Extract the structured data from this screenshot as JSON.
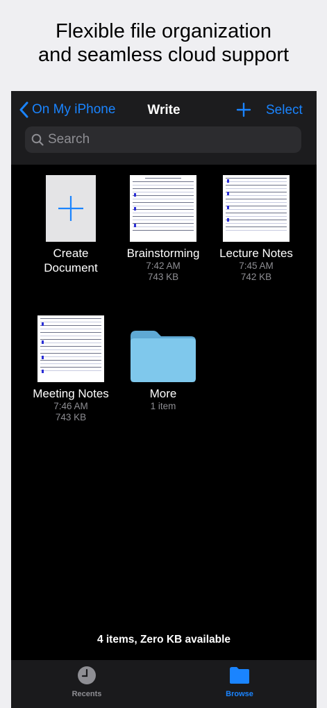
{
  "promo": {
    "line1": "Flexible file organization",
    "line2": "and seamless cloud support"
  },
  "nav": {
    "back_label": "On My iPhone",
    "title": "Write",
    "select_label": "Select"
  },
  "search": {
    "placeholder": "Search"
  },
  "files": {
    "create": {
      "line1": "Create",
      "line2": "Document"
    },
    "items": [
      {
        "name": "Brainstorming",
        "time": "7:42 AM",
        "size": "743 KB"
      },
      {
        "name": "Lecture Notes",
        "time": "7:45 AM",
        "size": "742 KB"
      },
      {
        "name": "Meeting Notes",
        "time": "7:46 AM",
        "size": "743 KB"
      },
      {
        "name": "More",
        "count": "1 item"
      }
    ]
  },
  "footer": {
    "status": "4 items, Zero KB available"
  },
  "tabs": [
    {
      "label": "Recents",
      "icon": "clock-icon",
      "active": false
    },
    {
      "label": "Browse",
      "icon": "folder-icon",
      "active": true
    }
  ],
  "colors": {
    "accent": "#1a84ff",
    "folder": "#7fc8ec",
    "background": "#000000"
  }
}
